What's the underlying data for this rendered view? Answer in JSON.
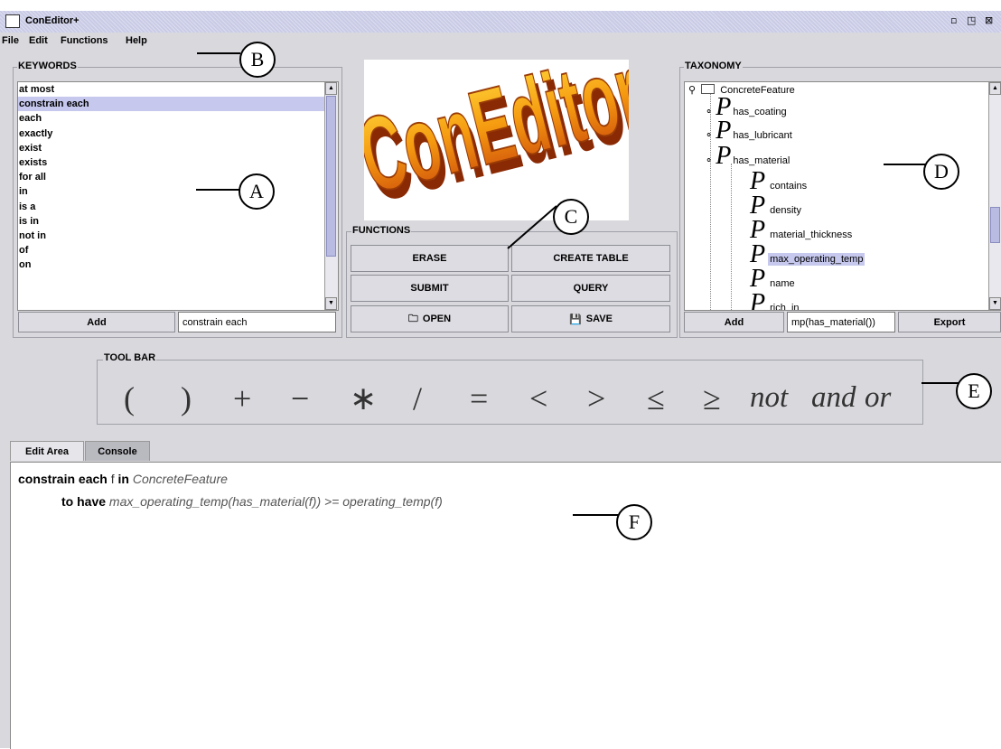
{
  "window": {
    "title": "ConEditor+"
  },
  "menu": [
    "File",
    "Edit",
    "Functions",
    "Help"
  ],
  "keywords": {
    "title": "KEYWORDS",
    "items": [
      "at most",
      "constrain each",
      "each",
      "exactly",
      "exist",
      "exists",
      "for all",
      "in",
      "is a",
      "is in",
      "not in",
      "of",
      "on"
    ],
    "selected_index": 1,
    "add_label": "Add",
    "field_value": "constrain each"
  },
  "logo": {
    "text": "ConEditor+"
  },
  "functions": {
    "title": "FUNCTIONS",
    "erase": "ERASE",
    "create_table": "CREATE TABLE",
    "submit": "SUBMIT",
    "query": "QUERY",
    "open": "OPEN",
    "save": "SAVE"
  },
  "taxonomy": {
    "title": "TAXONOMY",
    "root": "ConcreteFeature",
    "properties": [
      "has_coating",
      "has_lubricant",
      "has_material"
    ],
    "material_children": [
      "contains",
      "density",
      "material_thickness",
      "max_operating_temp",
      "name",
      "rich_in"
    ],
    "p_glyph": "P",
    "selected": "max_operating_temp",
    "add_label": "Add",
    "field_value": "mp(has_material())",
    "export_label": "Export"
  },
  "toolbar": {
    "title": "TOOL BAR",
    "symbols": [
      "(",
      ")",
      "+",
      "−",
      "∗",
      "/",
      "=",
      "<",
      ">",
      "≤",
      "≥"
    ],
    "words": [
      "not",
      "and",
      "or"
    ]
  },
  "tabs": [
    "Edit Area",
    "Console"
  ],
  "active_tab": 0,
  "editor": {
    "line1": {
      "kw1": "constrain each",
      "var": " f ",
      "kw2": "in",
      "concept": " ConcreteFeature"
    },
    "line2": {
      "kw": "to have",
      "expr": " max_operating_temp(has_material(f)) >= operating_temp(f)"
    }
  },
  "callouts": [
    "A",
    "B",
    "C",
    "D",
    "E",
    "F"
  ]
}
